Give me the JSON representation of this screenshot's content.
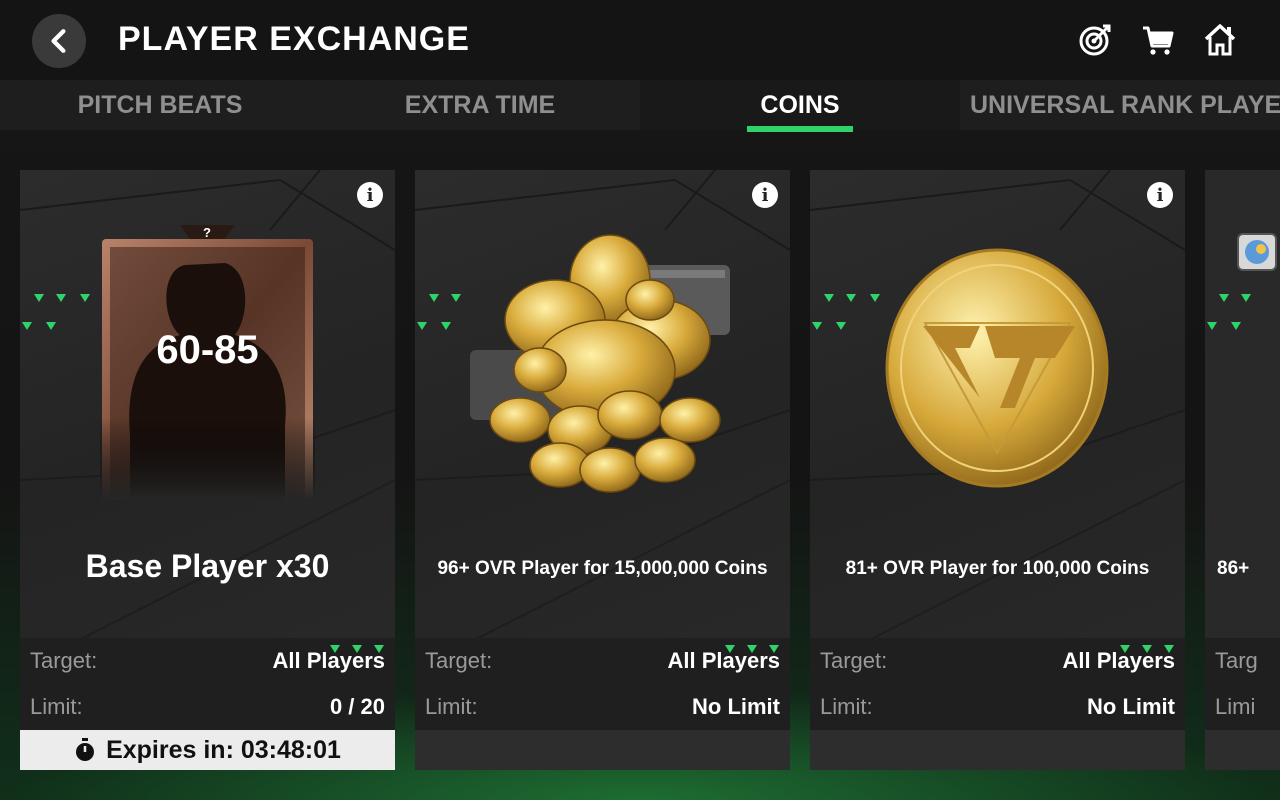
{
  "header": {
    "title": "PLAYER EXCHANGE",
    "back_icon": "chevron-left-icon",
    "objectives_icon": "target-icon",
    "shop_icon": "cart-icon",
    "home_icon": "home-icon"
  },
  "tabs": [
    {
      "label": "PITCH BEATS",
      "active": false
    },
    {
      "label": "EXTRA TIME",
      "active": false
    },
    {
      "label": "COINS",
      "active": true
    },
    {
      "label": "UNIVERSAL RANK PLAYER",
      "active": false
    }
  ],
  "colors": {
    "accent": "#2ed46a",
    "card_bg": "#262626",
    "bronze": "#8a5a3e"
  },
  "cards": [
    {
      "rating": "60-85",
      "badge": "?",
      "name": "Base Player x30",
      "target_label": "Target:",
      "target_value": "All Players",
      "limit_label": "Limit:",
      "limit_value": "0 / 20",
      "expires": "Expires in: 03:48:01"
    },
    {
      "name": "96+ OVR Player for 15,000,000 Coins",
      "target_label": "Target:",
      "target_value": "All Players",
      "limit_label": "Limit:",
      "limit_value": "No Limit"
    },
    {
      "name": "81+ OVR Player for 100,000 Coins",
      "target_label": "Target:",
      "target_value": "All Players",
      "limit_label": "Limit:",
      "limit_value": "No Limit"
    },
    {
      "name": "86+",
      "target_label": "Targ",
      "limit_label": "Limi"
    }
  ]
}
